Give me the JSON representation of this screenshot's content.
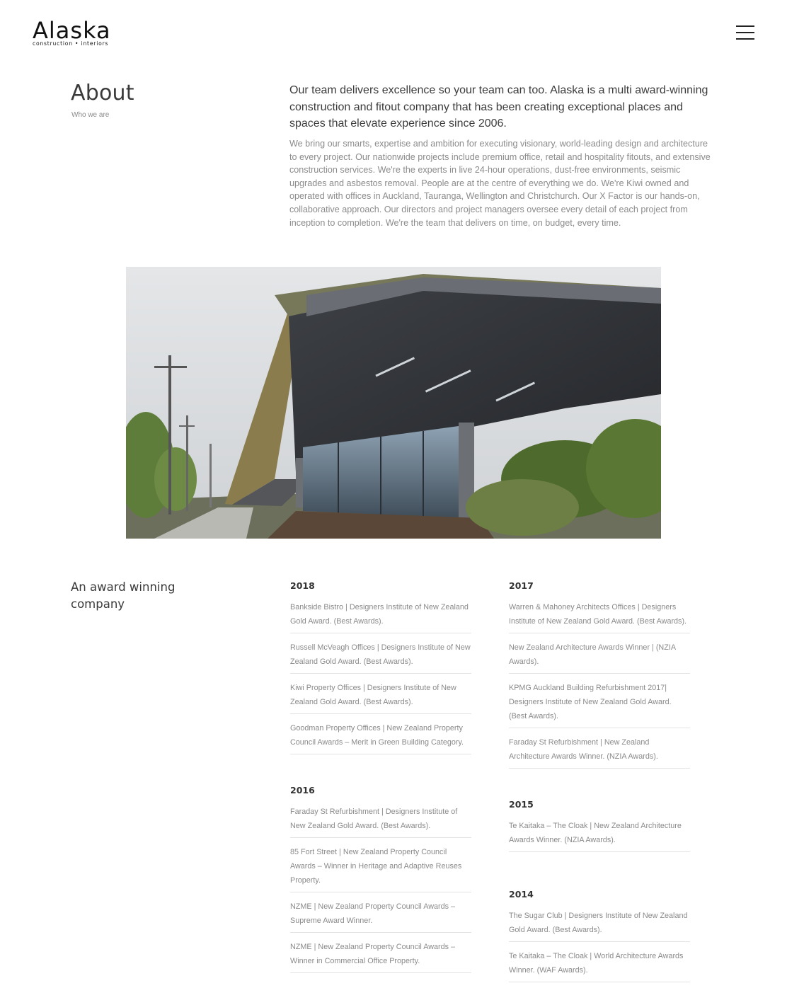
{
  "header": {
    "logo_word": "Alaska",
    "logo_sub": "construction • interiors",
    "menu_icon": "hamburger-menu-icon"
  },
  "about": {
    "title": "About",
    "subtitle": "Who we are",
    "intro": "Our team delivers excellence so your team can too. Alaska is a multi award-winning construction and fitout company that has been creating exceptional places and spaces that elevate experience since 2006.",
    "body": "We bring our smarts, expertise and ambition for executing visionary, world-leading design and architecture to every project. Our nationwide projects include premium office, retail and hospitality fitouts, and extensive construction services. We're the experts in live 24-hour operations, dust-free environments, seismic upgrades and asbestos removal. People are at the centre of everything we do. We're Kiwi owned and operated with offices in Auckland, Tauranga, Wellington and Christchurch. Our X Factor is our hands-on, collaborative approach. Our directors and project managers oversee every detail of each project from inception to completion. We're the team that delivers on time, on budget, every time."
  },
  "awards": {
    "heading": "An award winning company",
    "years": [
      {
        "year": "2018",
        "items": [
          "Bankside Bistro | Designers Institute of New Zealand Gold Award. (Best Awards).",
          "Russell McVeagh Offices | Designers Institute of New Zealand Gold Award. (Best Awards).",
          "Kiwi Property Offices | Designers Institute of New Zealand Gold Award. (Best Awards).",
          "Goodman Property Offices | New Zealand Property Council Awards – Merit in Green Building Category."
        ]
      },
      {
        "year": "2017",
        "items": [
          "Warren & Mahoney Architects Offices | Designers Institute of New Zealand Gold Award. (Best Awards).",
          "New Zealand Architecture Awards Winner | (NZIA Awards).",
          "KPMG Auckland Building Refurbishment 2017| Designers Institute of New Zealand Gold Award. (Best Awards).",
          "Faraday St Refurbishment | New Zealand Architecture Awards Winner. (NZIA Awards)."
        ]
      },
      {
        "year": "2016",
        "items": [
          "Faraday St Refurbishment | Designers Institute of New Zealand Gold Award. (Best Awards).",
          "85 Fort Street | New Zealand Property Council Awards – Winner in Heritage and Adaptive Reuses Property.",
          "NZME | New Zealand Property Council Awards – Supreme Award Winner.",
          "NZME | New Zealand Property Council Awards – Winner in Commercial Office Property."
        ]
      },
      {
        "year": "2015",
        "items": [
          "Te Kaitaka – The Cloak | New Zealand Architecture Awards Winner. (NZIA Awards)."
        ]
      },
      {
        "year": "2014",
        "items": [
          "The Sugar Club | Designers Institute of New Zealand Gold Award. (Best Awards).",
          "Te Kaitaka – The Cloak | World Architecture Awards Winner. (WAF Awards)."
        ]
      }
    ]
  }
}
